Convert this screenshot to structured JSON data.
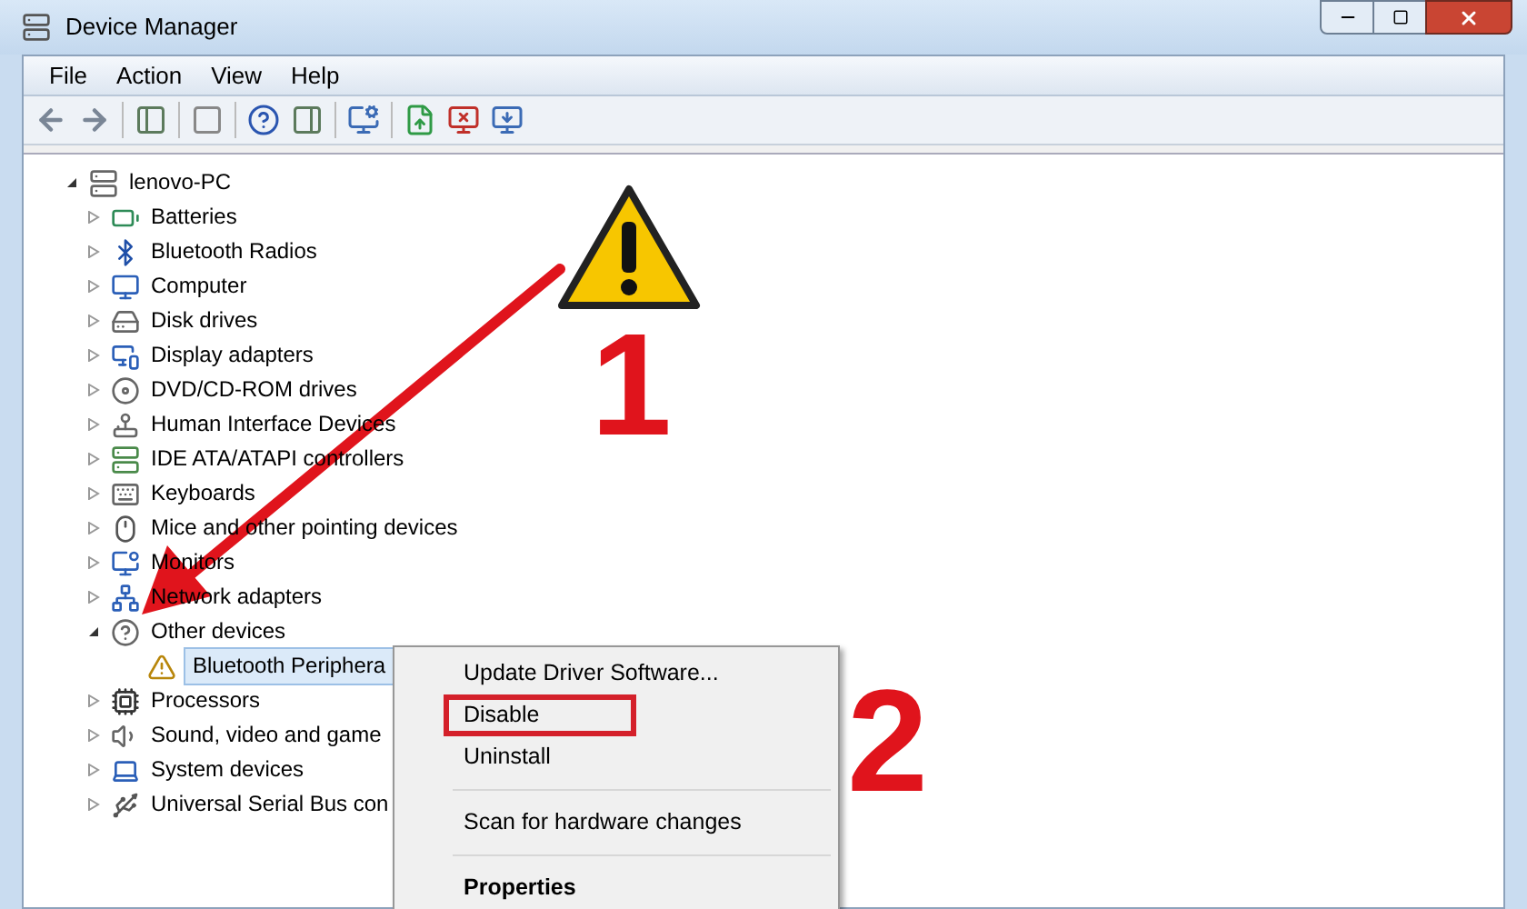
{
  "window": {
    "title": "Device Manager"
  },
  "menu_bar": [
    "File",
    "Action",
    "View",
    "Help"
  ],
  "tree": {
    "label": "lenovo-PC",
    "expanded": true,
    "selected": false,
    "children": [
      {
        "label": "Batteries",
        "expanded": false,
        "selected": false
      },
      {
        "label": "Bluetooth Radios",
        "expanded": false,
        "selected": false
      },
      {
        "label": "Computer",
        "expanded": false,
        "selected": false
      },
      {
        "label": "Disk drives",
        "expanded": false,
        "selected": false
      },
      {
        "label": "Display adapters",
        "expanded": false,
        "selected": false
      },
      {
        "label": "DVD/CD-ROM drives",
        "expanded": false,
        "selected": false
      },
      {
        "label": "Human Interface Devices",
        "expanded": false,
        "selected": false
      },
      {
        "label": "IDE ATA/ATAPI controllers",
        "expanded": false,
        "selected": false
      },
      {
        "label": "Keyboards",
        "expanded": false,
        "selected": false
      },
      {
        "label": "Mice and other pointing devices",
        "expanded": false,
        "selected": false
      },
      {
        "label": "Monitors",
        "expanded": false,
        "selected": false
      },
      {
        "label": "Network adapters",
        "expanded": false,
        "selected": false
      },
      {
        "label": "Other devices",
        "expanded": true,
        "selected": false,
        "children": [
          {
            "label": "Bluetooth Periphera",
            "selected": true
          }
        ]
      },
      {
        "label": "Processors",
        "expanded": false,
        "selected": false
      },
      {
        "label": "Sound, video and game",
        "expanded": false,
        "selected": false
      },
      {
        "label": "System devices",
        "expanded": false,
        "selected": false
      },
      {
        "label": "Universal Serial Bus con",
        "expanded": false,
        "selected": false
      }
    ]
  },
  "context_menu": [
    {
      "kind": "item",
      "label": "Update Driver Software...",
      "highlighted": false,
      "default": false
    },
    {
      "kind": "item",
      "label": "Disable",
      "highlighted": true,
      "default": false
    },
    {
      "kind": "item",
      "label": "Uninstall",
      "highlighted": false,
      "default": false
    },
    {
      "kind": "separator"
    },
    {
      "kind": "item",
      "label": "Scan for hardware changes",
      "highlighted": false,
      "default": false
    },
    {
      "kind": "separator"
    },
    {
      "kind": "item",
      "label": "Properties",
      "highlighted": false,
      "default": true
    }
  ],
  "annotations": [
    {
      "label": "1"
    },
    {
      "label": "2"
    }
  ]
}
